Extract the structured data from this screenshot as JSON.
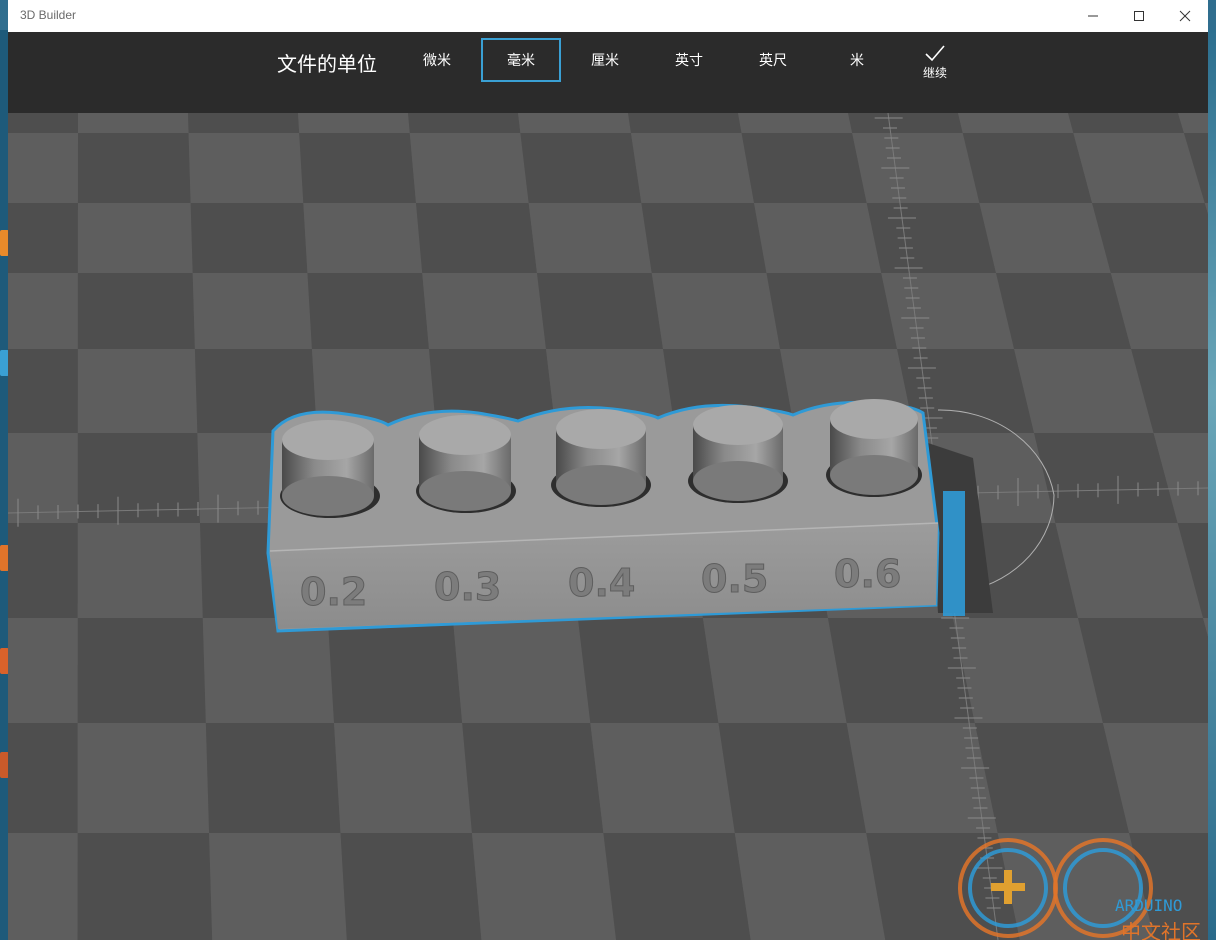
{
  "window": {
    "title": "3D Builder",
    "controls": [
      "minimize-icon",
      "maximize-icon",
      "close-icon"
    ]
  },
  "toolbar": {
    "heading": "文件的单位",
    "units": [
      {
        "label": "微米",
        "selected": false
      },
      {
        "label": "毫米",
        "selected": true
      },
      {
        "label": "厘米",
        "selected": false
      },
      {
        "label": "英寸",
        "selected": false
      },
      {
        "label": "英尺",
        "selected": false
      },
      {
        "label": "米",
        "selected": false
      }
    ],
    "continue_label": "继续",
    "continue_icon": "checkmark-icon"
  },
  "model": {
    "labels": [
      "0.2",
      "0.3",
      "0.4",
      "0.5",
      "0.6"
    ],
    "selection_color": "#2f9ad6"
  },
  "watermark": {
    "brand_text": "ARDUINO",
    "caption": "中文社区"
  },
  "colors": {
    "accent": "#3aa0d4",
    "toolbar_bg": "#2b2b2b",
    "floor_light": "#5e5e5e",
    "floor_dark": "#4e4e4e"
  }
}
